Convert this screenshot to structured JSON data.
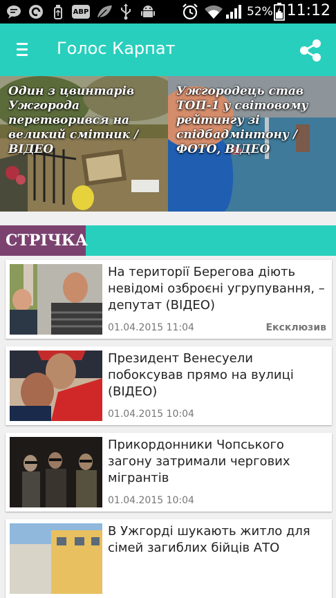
{
  "status_bar": {
    "battery_percent": "52%",
    "time": "11:12",
    "icons": [
      "chat-icon",
      "sync-icon",
      "usb-icon",
      "adblock-icon",
      "leaf-icon",
      "usb-icon",
      "android-icon",
      "alarm-icon",
      "wifi-icon",
      "signal-icon",
      "battery-icon"
    ],
    "adblock_label": "ABP"
  },
  "app_bar": {
    "title": "Голос Карпат",
    "menu_icon": "menu-icon",
    "share_icon": "share-icon"
  },
  "featured": [
    {
      "caption": "Один з цвинтарів Ужгорода перетворився на великий смітник / ВІДЕО"
    },
    {
      "caption": "Ужгородець став ТОП-1 у світовому рейтингу зі спідбадмінтону / ФОТО, ВІДЕО"
    }
  ],
  "section": {
    "label": "СТРІЧКА"
  },
  "news": [
    {
      "title": "На території Берегова діють невідомі озброєні угрупування, – депутат (ВІДЕО)",
      "date": "01.04.2015 11:04",
      "tag": "Ексклюзив"
    },
    {
      "title": "Президент Венесуели побоксував прямо на вулиці (ВІДЕО)",
      "date": "01.04.2015 10:04",
      "tag": ""
    },
    {
      "title": "Прикордонники Чопського загону затримали чергових мігрантів",
      "date": "01.04.2015 10:04",
      "tag": ""
    },
    {
      "title": "В Ужгорді шукають житло для сімей загиблих бійців АТО",
      "date": "",
      "tag": ""
    }
  ],
  "colors": {
    "accent": "#29cfbd",
    "section": "#7b4270"
  }
}
